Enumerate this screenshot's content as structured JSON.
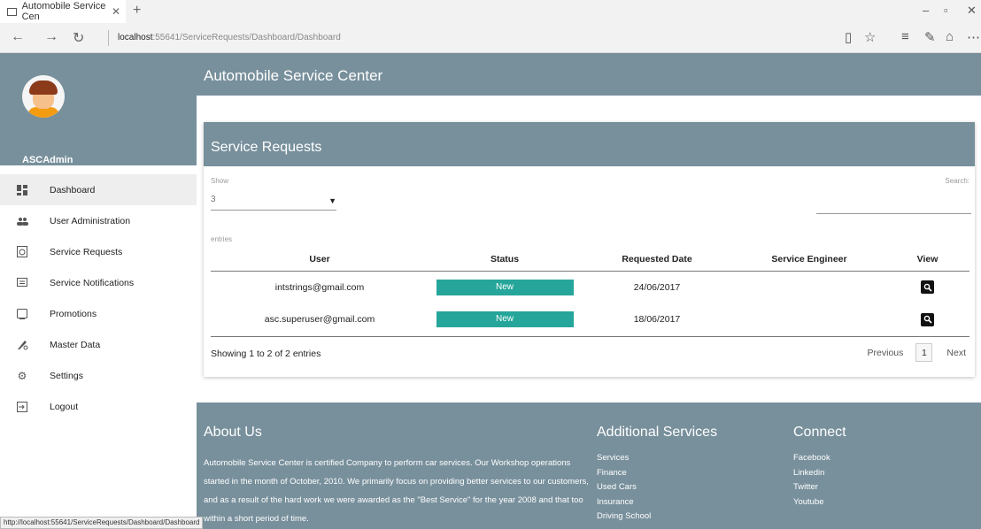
{
  "browser": {
    "tab_title": "Automobile Service Cen",
    "address_host": "localhost",
    "address_rest": ":55641/ServiceRequests/Dashboard/Dashboard",
    "status_url": "http://localhost:55641/ServiceRequests/Dashboard/Dashboard"
  },
  "app": {
    "title": "Automobile Service Center"
  },
  "user": {
    "name": "ASCAdmin",
    "email": "asc.superuser@gmail.com"
  },
  "sidebar": {
    "items": [
      {
        "label": "Dashboard",
        "icon": "dashboard-icon"
      },
      {
        "label": "User Administration",
        "icon": "users-icon"
      },
      {
        "label": "Service Requests",
        "icon": "clock-icon"
      },
      {
        "label": "Service Notifications",
        "icon": "message-icon"
      },
      {
        "label": "Promotions",
        "icon": "promotion-icon"
      },
      {
        "label": "Master Data",
        "icon": "master-data-icon"
      },
      {
        "label": "Settings",
        "icon": "gear-icon"
      },
      {
        "label": "Logout",
        "icon": "logout-icon"
      }
    ]
  },
  "card": {
    "title": "Service Requests",
    "show_label": "Show",
    "show_value": "3",
    "search_label": "Search:",
    "entries_label": "entries",
    "columns": [
      "User",
      "Status",
      "Requested Date",
      "Service Engineer",
      "View"
    ],
    "rows": [
      {
        "user": "intstrings@gmail.com",
        "status": "New",
        "date": "24/06/2017",
        "engineer": ""
      },
      {
        "user": "asc.superuser@gmail.com",
        "status": "New",
        "date": "18/06/2017",
        "engineer": ""
      }
    ],
    "showing": "Showing 1 to 2 of 2 entries",
    "previous": "Previous",
    "page": "1",
    "next": "Next"
  },
  "footer": {
    "about_title": "About Us",
    "about_text": "Automobile Service Center is certified Company to perform car services. Our Workshop operations started in the month of October, 2010. We primarily focus on providing better services to our customers, and as a result of the hard work we were awarded as the \"Best Service\" for the year 2008 and that too within a short period of time.",
    "additional_title": "Additional Services",
    "additional_items": [
      "Services",
      "Finance",
      "Used Cars",
      "Insurance",
      "Driving School"
    ],
    "connect_title": "Connect",
    "connect_items": [
      "Facebook",
      "Linkedin",
      "Twitter",
      "Youtube"
    ]
  },
  "colors": {
    "primary": "#78909c",
    "status_new": "#26a69a"
  }
}
